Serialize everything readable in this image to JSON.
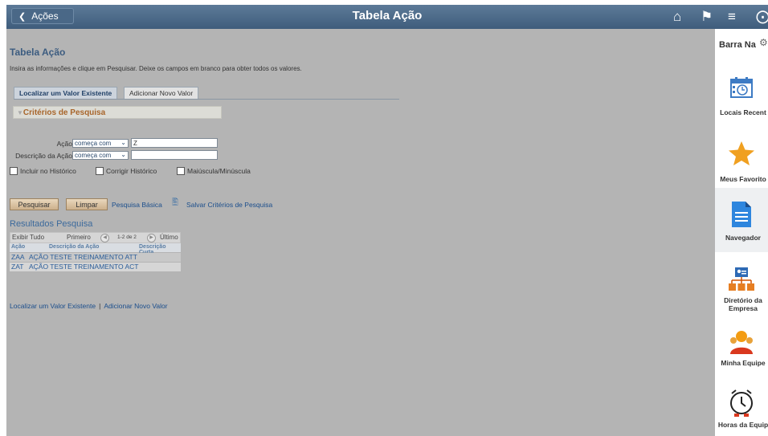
{
  "topbar": {
    "back_label": "Ações",
    "title": "Tabela Ação"
  },
  "page": {
    "heading": "Tabela Ação",
    "instructions": "Insira as informações e clique em Pesquisar. Deixe os campos em branco para obter todos os valores."
  },
  "tabs": [
    {
      "label": "Localizar um Valor Existente"
    },
    {
      "label": "Adicionar Novo Valor"
    }
  ],
  "criteria": {
    "title": "Critérios de Pesquisa",
    "fields": [
      {
        "label": "Ação",
        "operator": "começa com",
        "value": "Z"
      },
      {
        "label": "Descrição da Ação",
        "operator": "começa com",
        "value": ""
      }
    ],
    "checkboxes": [
      {
        "label": "Incluir no Histórico",
        "checked": false
      },
      {
        "label": "Corrigir Histórico",
        "checked": false
      },
      {
        "label": "Maiúscula/Minúscula",
        "checked": false
      }
    ]
  },
  "actions": {
    "search": "Pesquisar",
    "clear": "Limpar",
    "basic_search": "Pesquisa Básica",
    "save_criteria": "Salvar Critérios de Pesquisa"
  },
  "results": {
    "title": "Resultados Pesquisa",
    "show_all": "Exibir Tudo",
    "first": "Primeiro",
    "range": "1-2 de 2",
    "last": "Último",
    "columns": [
      "Ação",
      "Descrição da Ação",
      "Descrição Curta"
    ],
    "rows": [
      {
        "acao": "ZAA",
        "descricao": "AÇÃO TESTE TREINAMENTO ATT",
        "curta": ""
      },
      {
        "acao": "ZAT",
        "descricao": "AÇÃO TESTE TREINAMENTO ACT",
        "curta": ""
      }
    ]
  },
  "bottom_links": {
    "find": "Localizar um Valor Existente",
    "add": "Adicionar Novo Valor"
  },
  "sidebar": {
    "title": "Barra Na",
    "items": [
      {
        "label": "Locais Recent",
        "icon": "calendar-clock-icon"
      },
      {
        "label": "Meus Favorito",
        "icon": "star-icon"
      },
      {
        "label": "Navegador",
        "icon": "document-icon"
      },
      {
        "label": "Diretório da",
        "label2": "Empresa",
        "icon": "org-chart-icon"
      },
      {
        "label": "Minha Equipe",
        "icon": "team-icon"
      },
      {
        "label": "Horas da Equip",
        "icon": "alarm-clock-icon"
      }
    ]
  },
  "colors": {
    "topbar": "#4a6887",
    "background": "#b4b4b4",
    "link": "#1b4e8c",
    "criteria_title": "#a8652a",
    "star": "#f0a020"
  }
}
